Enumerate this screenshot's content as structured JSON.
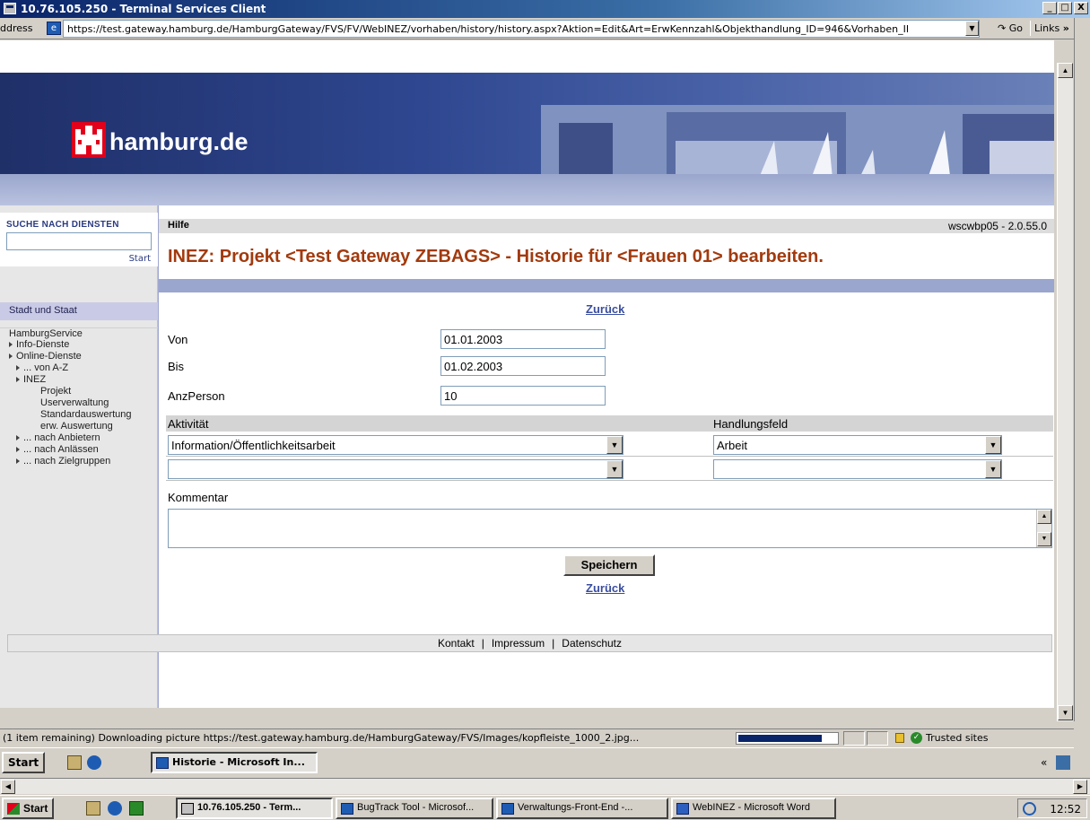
{
  "window": {
    "title": "10.76.105.250 - Terminal Services Client",
    "minimize": "_",
    "maximize": "□",
    "close": "X"
  },
  "address": {
    "label": "ddress",
    "url": "https://test.gateway.hamburg.de/HamburgGateway/FVS/FV/WebINEZ/vorhaben/history/history.aspx?Aktion=Edit&Art=ErwKennzahl&Objekthandlung_ID=946&Vorhaben_II",
    "go_label": "Go",
    "links_label": "Links"
  },
  "banner": {
    "brand": "hamburg.de"
  },
  "sidebar": {
    "search_title": "SUCHE NACH DIENSTEN",
    "search_button": "Start",
    "nav_header": "Stadt und Staat",
    "items": [
      {
        "label": "HamburgService",
        "level": "l1",
        "tri": false
      },
      {
        "label": "Info-Dienste",
        "level": "l1",
        "tri": true
      },
      {
        "label": "Online-Dienste",
        "level": "l1",
        "tri": true
      },
      {
        "label": "... von A-Z",
        "level": "l2",
        "tri": true
      },
      {
        "label": "INEZ",
        "level": "l2",
        "tri": true
      },
      {
        "label": "Projekt",
        "level": "l3",
        "tri": false
      },
      {
        "label": "Userverwaltung",
        "level": "l3",
        "tri": false
      },
      {
        "label": "Standardauswertung",
        "level": "l3",
        "tri": false
      },
      {
        "label": "erw. Auswertung",
        "level": "l3",
        "tri": false
      },
      {
        "label": "... nach Anbietern",
        "level": "l2",
        "tri": true
      },
      {
        "label": "... nach Anlässen",
        "level": "l2",
        "tri": true
      },
      {
        "label": "... nach Zielgruppen",
        "level": "l2",
        "tri": true
      }
    ]
  },
  "content": {
    "hilfe": "Hilfe",
    "version": "wscwbp05 - 2.0.55.0",
    "title": "INEZ: Projekt <Test Gateway ZEBAGS> - Historie für <Frauen 01> bearbeiten.",
    "back_link": "Zurück",
    "von_label": "Von",
    "von_value": "01.01.2003",
    "bis_label": "Bis",
    "bis_value": "01.02.2003",
    "anz_label": "AnzPerson",
    "anz_value": "10",
    "col_aktivitaet": "Aktivität",
    "col_handlungsfeld": "Handlungsfeld",
    "row1_aktivitaet": "Information/Öffentlichkeitsarbeit",
    "row1_handlungsfeld": "Arbeit",
    "row2_aktivitaet": "",
    "row2_handlungsfeld": "",
    "kommentar_label": "Kommentar",
    "save_label": "Speichern"
  },
  "footer": {
    "kontakt": "Kontakt",
    "impressum": "Impressum",
    "datenschutz": "Datenschutz",
    "sep": "|"
  },
  "status": {
    "text": "(1 item remaining) Downloading picture https://test.gateway.hamburg.de/HamburgGateway/FVS/Images/kopfleiste_1000_2.jpg...",
    "progress": 0.85,
    "zone": "Trusted sites"
  },
  "inner_taskbar": {
    "start": "Start",
    "task_active": "Historie - Microsoft In..."
  },
  "outer_taskbar": {
    "start": "Start",
    "tasks": [
      "10.76.105.250 - Term...",
      "BugTrack Tool - Microsof...",
      "Verwaltungs-Front-End -...",
      "WebINEZ - Microsoft Word"
    ],
    "time": "12:52"
  },
  "colors": {
    "title_accent": "#a23a0d",
    "link": "#3a4ea0",
    "banner": "#2e4790"
  }
}
